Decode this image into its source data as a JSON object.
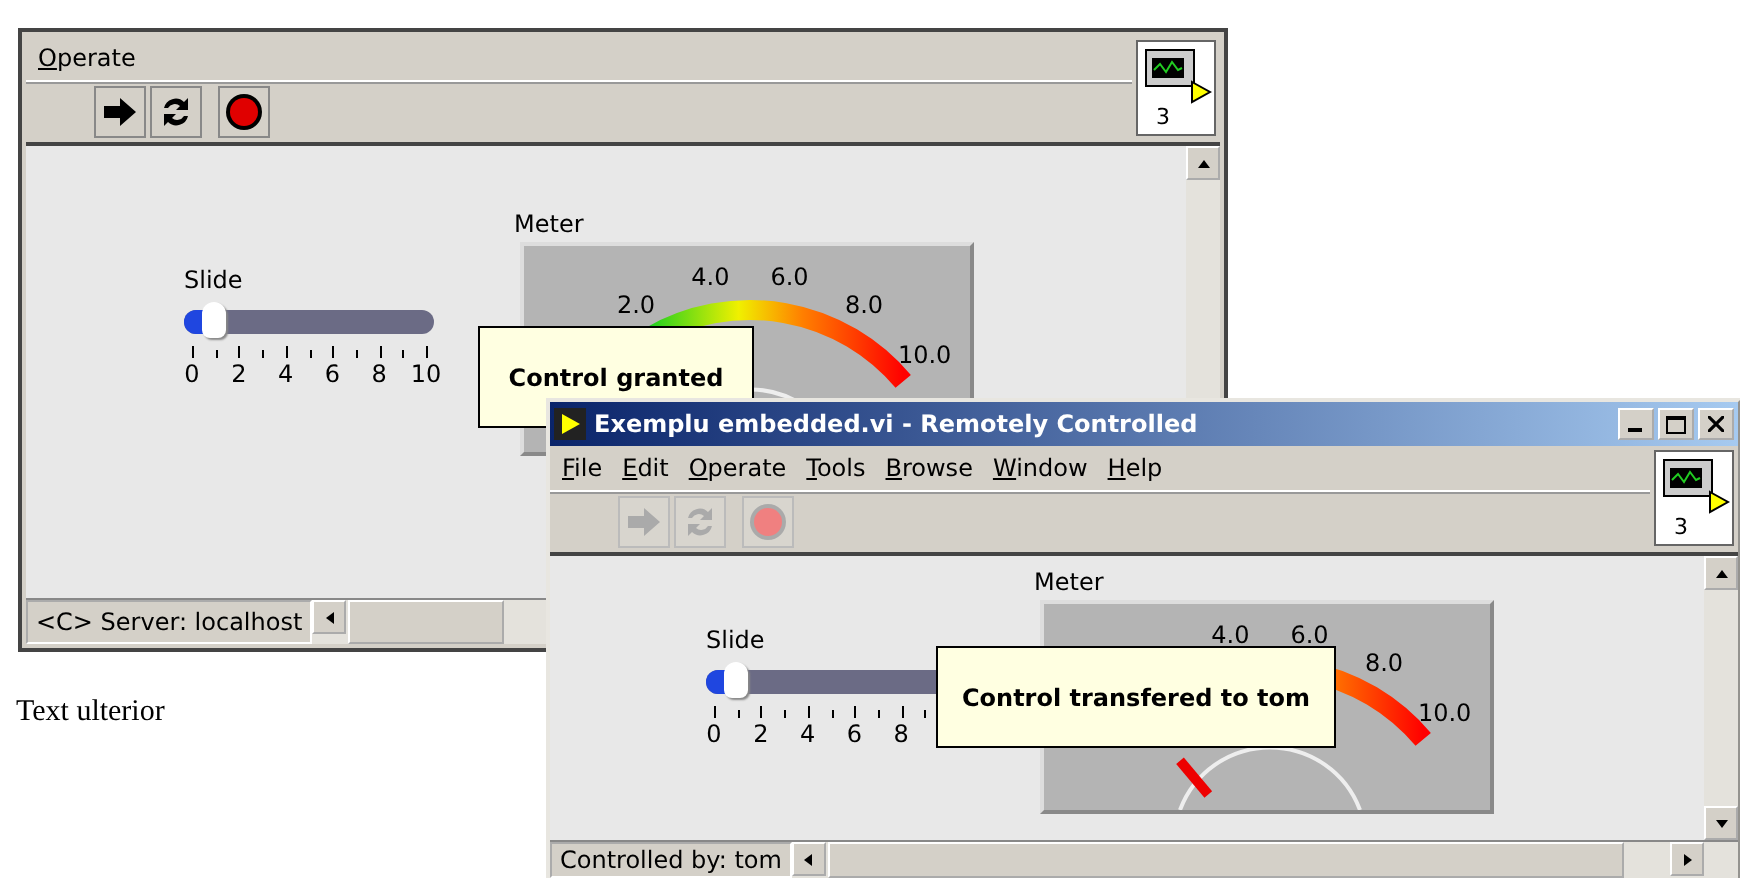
{
  "embedded_panel": {
    "menu": [
      {
        "label": "Operate"
      }
    ],
    "toolbar": {
      "disabled": false
    },
    "vi_icon": {
      "number": "3"
    },
    "slide": {
      "label": "Slide",
      "level": 0.12,
      "ticks": [
        "0",
        "2",
        "4",
        "6",
        "8",
        "10"
      ]
    },
    "meter": {
      "label": "Meter",
      "ticks": [
        "2.0",
        "4.0",
        "6.0",
        "8.0",
        "10.0"
      ]
    },
    "tooltip": "Control granted",
    "status": "<C> Server: localhost"
  },
  "page_text": "Text ulterior",
  "remote_window": {
    "title": "Exemplu embedded.vi - Remotely Controlled",
    "menu": [
      {
        "label": "File"
      },
      {
        "label": "Edit"
      },
      {
        "label": "Operate"
      },
      {
        "label": "Tools"
      },
      {
        "label": "Browse"
      },
      {
        "label": "Window"
      },
      {
        "label": "Help"
      }
    ],
    "toolbar": {
      "disabled": true
    },
    "vi_icon": {
      "number": "3"
    },
    "slide": {
      "label": "Slide",
      "level": 0.12,
      "ticks": [
        "0",
        "2",
        "4",
        "6",
        "8"
      ]
    },
    "meter": {
      "label": "Meter",
      "ticks": [
        "4.0",
        "6.0",
        "8.0",
        "10.0"
      ]
    },
    "tooltip": "Control transfered to tom",
    "status": "Controlled by: tom"
  }
}
